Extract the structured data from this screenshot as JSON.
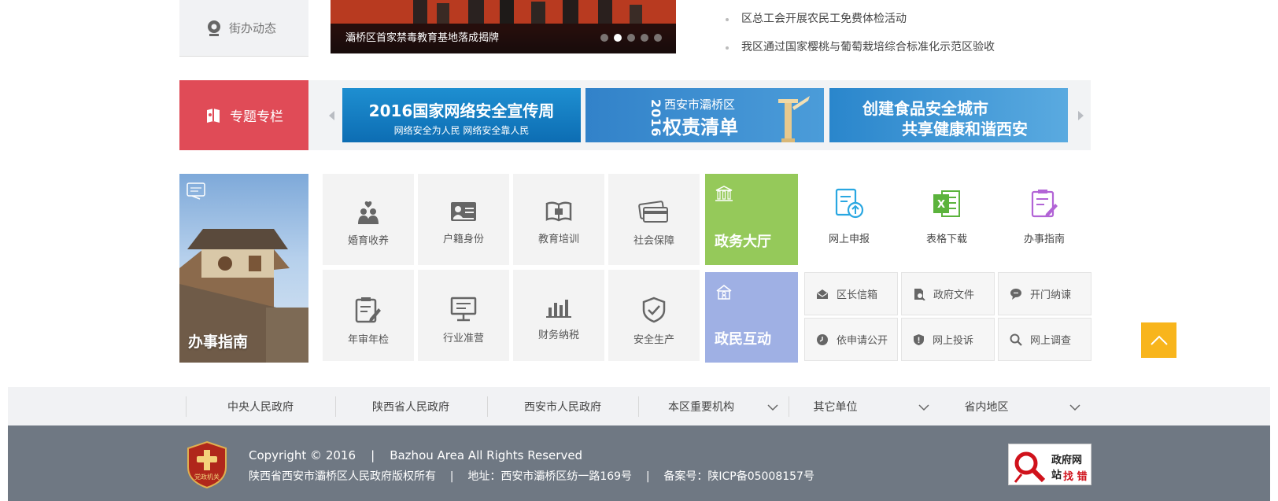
{
  "side_nav": {
    "item_label": "街办动态"
  },
  "slideshow": {
    "caption": "灞桥区首家禁毒教育基地落成揭牌",
    "active_dot": 2,
    "dot_count": 5
  },
  "news": {
    "items": [
      "区总工会开展农民工免费体检活动",
      "我区通过国家樱桃与葡萄栽培综合标准化示范区验收"
    ]
  },
  "special": {
    "title": "专题专栏",
    "banners": [
      {
        "line1": "2016国家网络安全宣传周",
        "line2": "网络安全为人民 网络安全靠人民"
      },
      {
        "year": "2016",
        "line1": "西安市灞桥区",
        "line2": "权责清单"
      },
      {
        "line1": "创建食品安全城市",
        "line2": "共享健康和谐西安"
      }
    ]
  },
  "guide": {
    "photo_label": "办事指南",
    "tiles_row1": [
      "婚育收养",
      "户籍身份",
      "教育培训",
      "社会保障"
    ],
    "tiles_row2": [
      "年审年检",
      "行业准营",
      "财务纳税",
      "安全生产"
    ]
  },
  "hall": {
    "title": "政务大厅",
    "color": "#95c95a",
    "services": [
      "网上申报",
      "表格下载",
      "办事指南"
    ]
  },
  "interaction": {
    "title": "政民互动",
    "color": "#9fb0e4",
    "items_row1": [
      "区长信箱",
      "政府文件",
      "开门纳谏"
    ],
    "items_row2": [
      "依申请公开",
      "网上投诉",
      "网上调查"
    ]
  },
  "links_bar": {
    "links": [
      "中央人民政府",
      "陕西省人民政府",
      "西安市人民政府"
    ],
    "dropdowns": [
      "本区重要机构",
      "其它单位",
      "省内地区"
    ]
  },
  "footer": {
    "copyright": "Copyright © 2016    |    Bazhou Area All Rights Reserved",
    "info": "陕西省西安市灞桥区人民政府版权所有    |    地址：西安市灞桥区纺一路169号    |    备案号：陕ICP备05008157号",
    "badge_top": "政府网站",
    "badge_bottom": "找 错",
    "logo_text": "党政机关"
  },
  "colors": {
    "special_red": "#e04b57",
    "accent_orange": "#f8b51c",
    "footer_bg": "#6f7883"
  }
}
